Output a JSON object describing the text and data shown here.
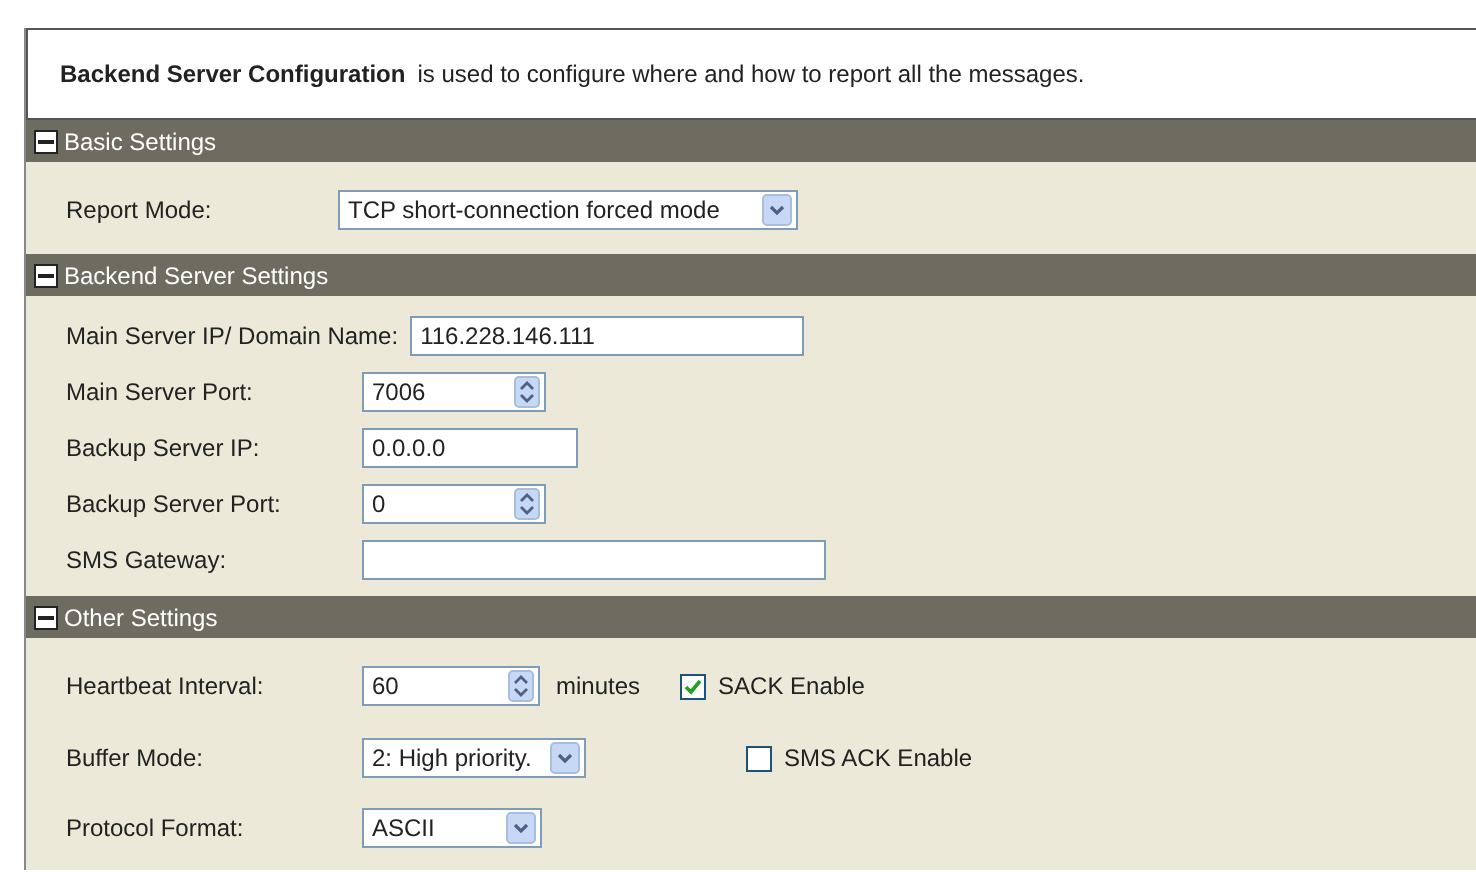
{
  "intro": {
    "title": "Backend Server Configuration",
    "text": "is used to configure where and how to report all the messages."
  },
  "sections": [
    {
      "title": "Basic Settings",
      "expanded": true,
      "rows": [
        {
          "label": "Report Mode:",
          "kind": "select",
          "value": "TCP short-connection forced mode"
        }
      ]
    },
    {
      "title": "Backend Server Settings",
      "expanded": true,
      "rows": [
        {
          "label": "Main Server IP/ Domain Name:",
          "kind": "text",
          "value": "116.228.146.111"
        },
        {
          "label": "Main Server Port:",
          "kind": "spinner",
          "value": "7006"
        },
        {
          "label": "Backup Server IP:",
          "kind": "text",
          "value": "0.0.0.0"
        },
        {
          "label": "Backup Server Port:",
          "kind": "spinner",
          "value": "0"
        },
        {
          "label": "SMS Gateway:",
          "kind": "text"
        }
      ]
    },
    {
      "title": "Other Settings",
      "expanded": true,
      "rows": [
        {
          "label": "Heartbeat Interval:",
          "kind": "spinner",
          "value": "60",
          "unit": "minutes",
          "checkbox": {
            "label": "SACK Enable",
            "checked": true
          }
        },
        {
          "label": "Buffer Mode:",
          "kind": "select",
          "value": "2: High priority.",
          "checkbox": {
            "label": "SMS ACK Enable",
            "checked": false
          }
        },
        {
          "label": "Protocol Format:",
          "kind": "select",
          "value": "ASCII"
        }
      ]
    }
  ]
}
